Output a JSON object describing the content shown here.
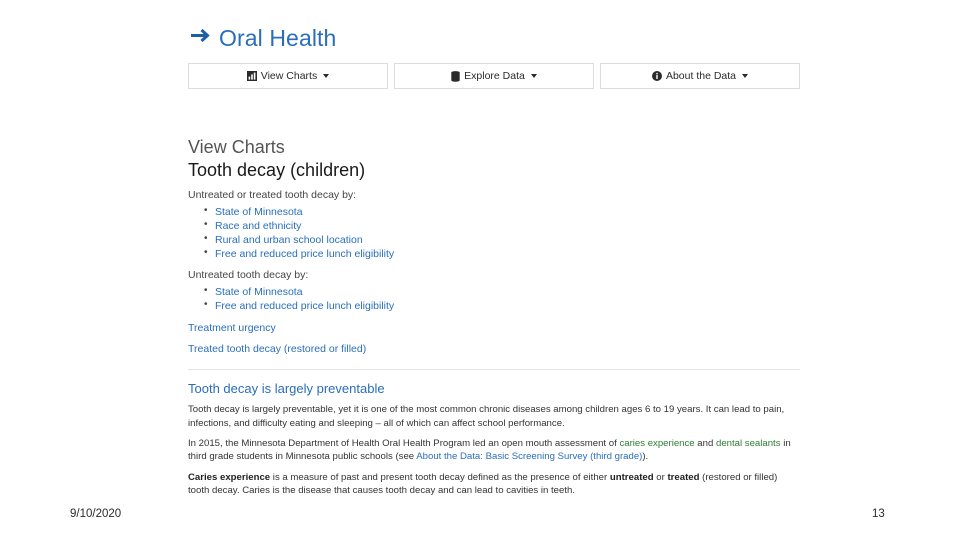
{
  "site": {
    "title": "Oral Health",
    "arrow_icon": "arrow-right-icon"
  },
  "nav": {
    "buttons": [
      {
        "label": "View Charts",
        "icon": "bar-chart-icon",
        "has_caret": true
      },
      {
        "label": "Explore Data",
        "icon": "database-icon",
        "has_caret": true
      },
      {
        "label": "About the Data",
        "icon": "info-circle-icon",
        "has_caret": true
      }
    ]
  },
  "main": {
    "section_label": "View Charts",
    "topic_title": "Tooth decay (children)",
    "group1": {
      "lead": "Untreated or treated tooth decay by:",
      "links": [
        "State of Minnesota",
        "Race and ethnicity",
        "Rural and urban school location",
        "Free and reduced price lunch eligibility"
      ]
    },
    "group2": {
      "lead": "Untreated tooth decay by:",
      "links": [
        "State of Minnesota",
        "Free and reduced price lunch eligibility"
      ]
    },
    "standalone_links": [
      "Treatment urgency",
      "Treated tooth decay (restored or filled)"
    ],
    "preventable": {
      "heading": "Tooth decay is largely preventable",
      "para1": "Tooth decay is largely preventable, yet it is one of the most common chronic diseases among children ages 6 to 19 years. It can lead to pain, infections, and difficulty eating and sleeping – all of which can affect school performance.",
      "para2_part1": "In 2015, the Minnesota Department of Health Oral Health Program led an open mouth assessment of ",
      "para2_link1": "caries experience",
      "para2_mid": " and ",
      "para2_link2": "dental sealants",
      "para2_part2": " in third grade students in Minnesota public schools (see ",
      "para2_link3": "About the Data: Basic Screening Survey (third grade)",
      "para2_end": ").",
      "para3_bold1": "Caries experience",
      "para3_part1": " is a measure of past and present tooth decay defined as the presence of either ",
      "para3_bold2": "untreated",
      "para3_mid": " or ",
      "para3_bold3": "treated",
      "para3_part2": " (restored or filled) tooth decay.  Caries is the disease that causes tooth decay and can lead to cavities in teeth."
    }
  },
  "footer": {
    "date": "9/10/2020",
    "page_number": "13"
  },
  "colors": {
    "link_blue": "#2a6ebb",
    "arrow_blue": "#1c5ea8",
    "green_link": "#2e7d32"
  }
}
